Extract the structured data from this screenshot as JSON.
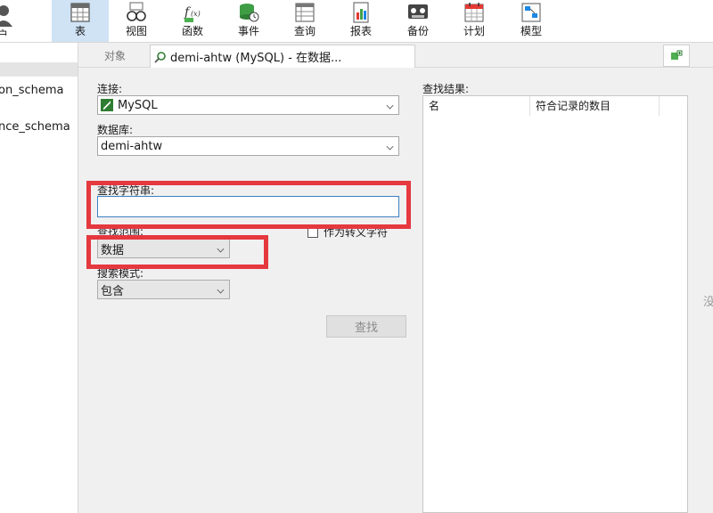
{
  "toolbar": {
    "user_label": "户",
    "items": [
      {
        "label": "表",
        "icon": "table-icon",
        "active": true
      },
      {
        "label": "视图",
        "icon": "view-glasses-icon"
      },
      {
        "label": "函数",
        "icon": "function-icon"
      },
      {
        "label": "事件",
        "icon": "event-clock-icon"
      },
      {
        "label": "查询",
        "icon": "query-icon"
      },
      {
        "label": "报表",
        "icon": "report-icon"
      },
      {
        "label": "备份",
        "icon": "backup-icon"
      },
      {
        "label": "计划",
        "icon": "schedule-calendar-icon"
      },
      {
        "label": "模型",
        "icon": "model-icon"
      }
    ]
  },
  "nav": {
    "items": [
      "on_schema",
      "nce_schema"
    ]
  },
  "tabs": {
    "objects": "对象",
    "active": "demi-ahtw (MySQL) - 在数据..."
  },
  "form": {
    "connection_label": "连接:",
    "connection_value": "MySQL",
    "database_label": "数据库:",
    "database_value": "demi-ahtw",
    "find_string_label": "查找字符串:",
    "find_string_value": "",
    "scope_label": "查找范围:",
    "scope_value": "数据",
    "escape_label": "作为转义字符",
    "mode_label": "搜索模式:",
    "mode_value": "包含",
    "find_button": "查找"
  },
  "results": {
    "title": "查找结果:",
    "columns": [
      "名",
      "符合记录的数目"
    ]
  },
  "side_hint": "没",
  "colors": {
    "highlight": "#e5383f",
    "active_tab_bg": "#cfe3f5",
    "mysql_green": "#2e7d32"
  }
}
